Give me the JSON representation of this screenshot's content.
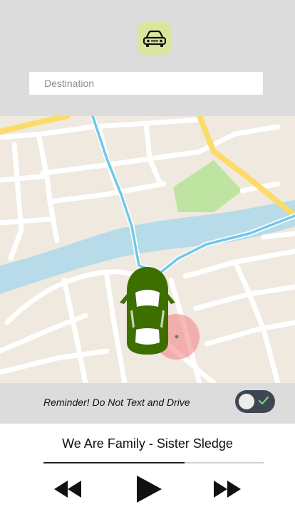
{
  "header": {
    "logo_icon": "car-icon",
    "destination_placeholder": "Destination"
  },
  "map": {
    "vehicle_icon": "car-top-view-icon",
    "location_marker": "current-location-marker"
  },
  "reminder": {
    "text": "Reminder! Do Not Text and Drive",
    "toggle_state": "on"
  },
  "player": {
    "song_title": "We Are Family - Sister Sledge",
    "progress": 0.64,
    "controls": [
      "rewind-icon",
      "play-icon",
      "fast-forward-icon"
    ]
  },
  "colors": {
    "header_bg": "#dcdcdc",
    "logo_bg": "#d8e6a0",
    "car": "#3d6e00",
    "toggle_bg": "#3e4653",
    "check": "#7fd17f",
    "marker": "#f08080"
  }
}
